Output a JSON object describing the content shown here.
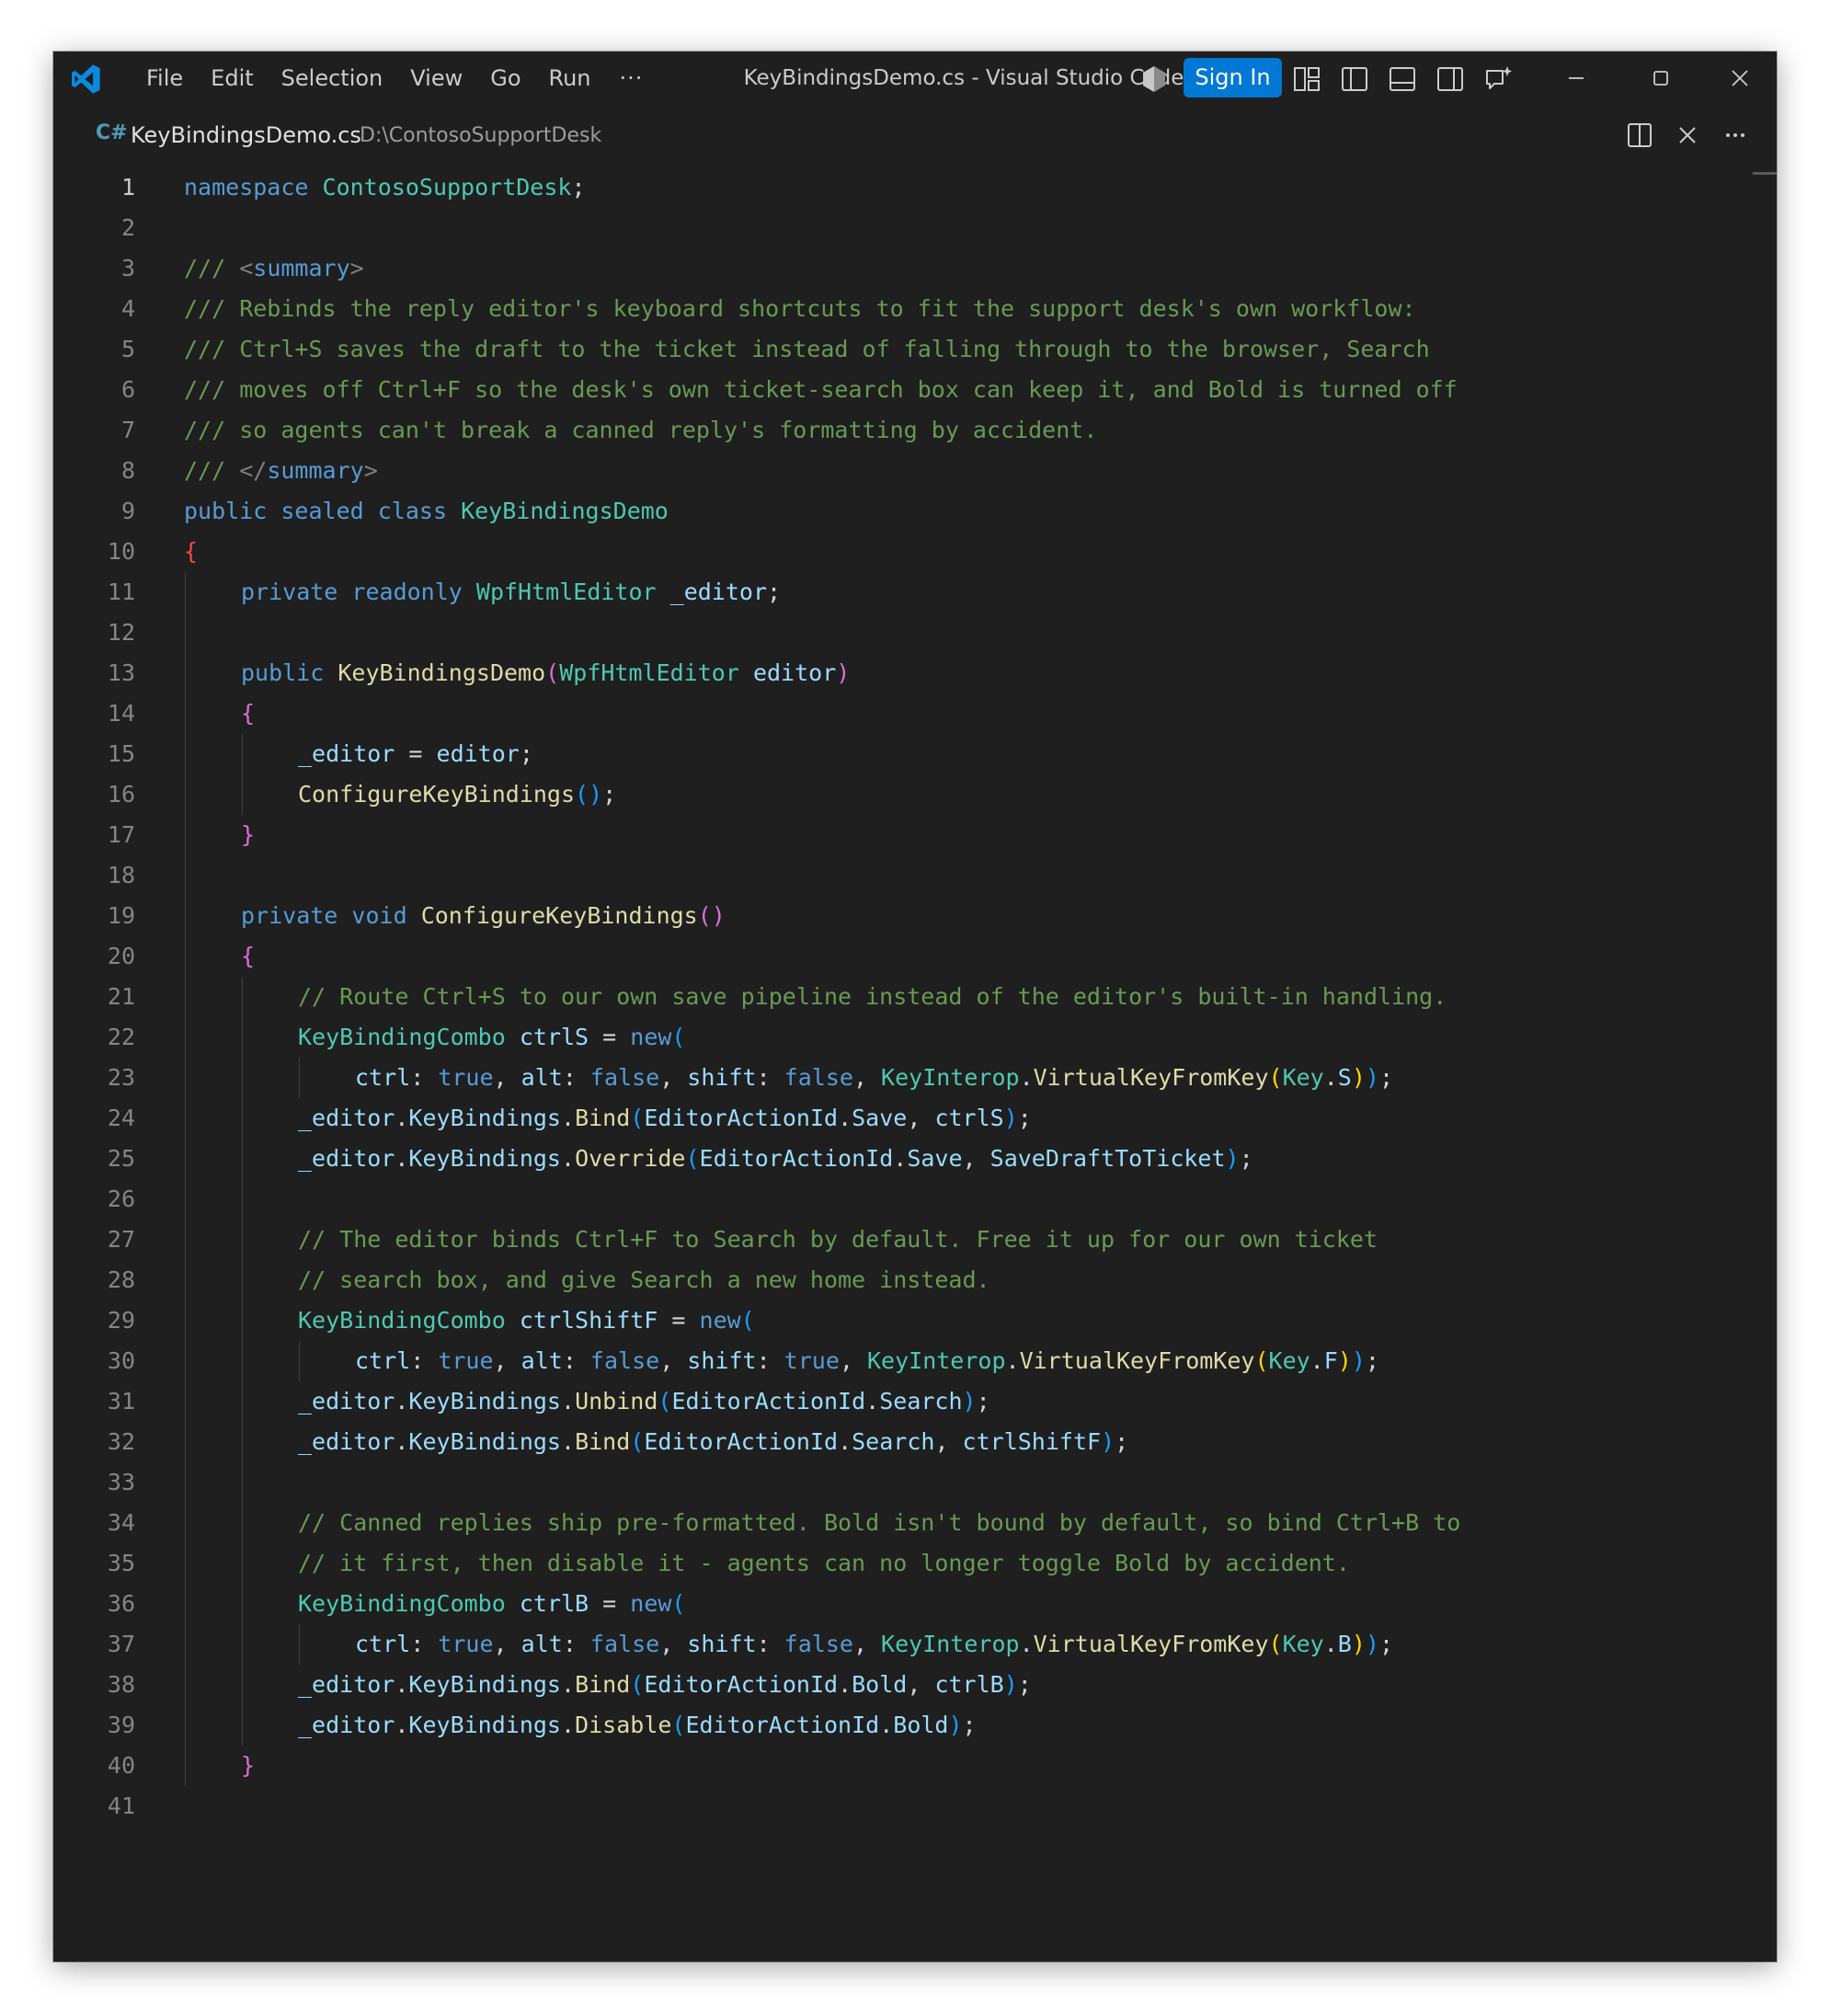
{
  "titlebar": {
    "menu": [
      "File",
      "Edit",
      "Selection",
      "View",
      "Go",
      "Run"
    ],
    "more": "···",
    "title": "KeyBindingsDemo.cs - Visual Studio Code",
    "signin": "Sign In"
  },
  "editor": {
    "file_icon": "C#",
    "file_name": "KeyBindingsDemo.cs",
    "file_path": "D:\\ContosoSupportDesk",
    "active_line": 1
  },
  "code_lines": [
    {
      "n": "1",
      "indent": 0,
      "t": [
        [
          "namespace",
          "kw"
        ],
        [
          " ",
          "pl"
        ],
        [
          "ContosoSupportDesk",
          "ty"
        ],
        [
          ";",
          "pl"
        ]
      ]
    },
    {
      "n": "2",
      "indent": 0,
      "t": []
    },
    {
      "n": "3",
      "indent": 0,
      "t": [
        [
          "/// ",
          "cm"
        ],
        [
          "<",
          "xc"
        ],
        [
          "summary",
          "xd"
        ],
        [
          ">",
          "xc"
        ]
      ]
    },
    {
      "n": "4",
      "indent": 0,
      "t": [
        [
          "/// Rebinds the reply editor's keyboard shortcuts to fit the support desk's own workflow:",
          "cm"
        ]
      ]
    },
    {
      "n": "5",
      "indent": 0,
      "t": [
        [
          "/// Ctrl+S saves the draft to the ticket instead of falling through to the browser, Search",
          "cm"
        ]
      ]
    },
    {
      "n": "6",
      "indent": 0,
      "t": [
        [
          "/// moves off Ctrl+F so the desk's own ticket-search box can keep it, and Bold is turned off",
          "cm"
        ]
      ]
    },
    {
      "n": "7",
      "indent": 0,
      "t": [
        [
          "/// so agents can't break a canned reply's formatting by accident.",
          "cm"
        ]
      ]
    },
    {
      "n": "8",
      "indent": 0,
      "t": [
        [
          "/// ",
          "cm"
        ],
        [
          "</",
          "xc"
        ],
        [
          "summary",
          "xd"
        ],
        [
          ">",
          "xc"
        ]
      ]
    },
    {
      "n": "9",
      "indent": 0,
      "t": [
        [
          "public",
          "kw"
        ],
        [
          " ",
          "pl"
        ],
        [
          "sealed",
          "kw"
        ],
        [
          " ",
          "pl"
        ],
        [
          "class",
          "kw"
        ],
        [
          " ",
          "pl"
        ],
        [
          "KeyBindingsDemo",
          "ty"
        ]
      ]
    },
    {
      "n": "10",
      "indent": 0,
      "t": [
        [
          "{",
          "er"
        ]
      ]
    },
    {
      "n": "11",
      "indent": 1,
      "t": [
        [
          "private",
          "kw"
        ],
        [
          " ",
          "pl"
        ],
        [
          "readonly",
          "kw"
        ],
        [
          " ",
          "pl"
        ],
        [
          "WpfHtmlEditor",
          "ty"
        ],
        [
          " ",
          "pl"
        ],
        [
          "_editor",
          "va"
        ],
        [
          ";",
          "pl"
        ]
      ]
    },
    {
      "n": "12",
      "indent": 0,
      "t": []
    },
    {
      "n": "13",
      "indent": 1,
      "t": [
        [
          "public",
          "kw"
        ],
        [
          " ",
          "pl"
        ],
        [
          "KeyBindingsDemo",
          "fn"
        ],
        [
          "(",
          "b2"
        ],
        [
          "WpfHtmlEditor",
          "ty"
        ],
        [
          " ",
          "pl"
        ],
        [
          "editor",
          "va"
        ],
        [
          ")",
          "b2"
        ]
      ]
    },
    {
      "n": "14",
      "indent": 1,
      "t": [
        [
          "{",
          "b2"
        ]
      ]
    },
    {
      "n": "15",
      "indent": 2,
      "t": [
        [
          "_editor",
          "va"
        ],
        [
          " = ",
          "pl"
        ],
        [
          "editor",
          "va"
        ],
        [
          ";",
          "pl"
        ]
      ]
    },
    {
      "n": "16",
      "indent": 2,
      "t": [
        [
          "ConfigureKeyBindings",
          "fn"
        ],
        [
          "()",
          "b3"
        ],
        [
          ";",
          "pl"
        ]
      ]
    },
    {
      "n": "17",
      "indent": 1,
      "t": [
        [
          "}",
          "b2"
        ]
      ]
    },
    {
      "n": "18",
      "indent": 0,
      "t": []
    },
    {
      "n": "19",
      "indent": 1,
      "t": [
        [
          "private",
          "kw"
        ],
        [
          " ",
          "pl"
        ],
        [
          "void",
          "kw"
        ],
        [
          " ",
          "pl"
        ],
        [
          "ConfigureKeyBindings",
          "fn"
        ],
        [
          "()",
          "b2"
        ]
      ]
    },
    {
      "n": "20",
      "indent": 1,
      "t": [
        [
          "{",
          "b2"
        ]
      ]
    },
    {
      "n": "21",
      "indent": 2,
      "t": [
        [
          "// Route Ctrl+S to our own save pipeline instead of the editor's built-in handling.",
          "cm"
        ]
      ]
    },
    {
      "n": "22",
      "indent": 2,
      "t": [
        [
          "KeyBindingCombo",
          "ty"
        ],
        [
          " ",
          "pl"
        ],
        [
          "ctrlS",
          "va"
        ],
        [
          " = ",
          "pl"
        ],
        [
          "new",
          "kw"
        ],
        [
          "(",
          "b3"
        ]
      ]
    },
    {
      "n": "23",
      "indent": 3,
      "t": [
        [
          "ctrl",
          "va"
        ],
        [
          ": ",
          "pl"
        ],
        [
          "true",
          "kw"
        ],
        [
          ", ",
          "pl"
        ],
        [
          "alt",
          "va"
        ],
        [
          ": ",
          "pl"
        ],
        [
          "false",
          "kw"
        ],
        [
          ", ",
          "pl"
        ],
        [
          "shift",
          "va"
        ],
        [
          ": ",
          "pl"
        ],
        [
          "false",
          "kw"
        ],
        [
          ", ",
          "pl"
        ],
        [
          "KeyInterop",
          "ty"
        ],
        [
          ".",
          "pl"
        ],
        [
          "VirtualKeyFromKey",
          "fn"
        ],
        [
          "(",
          "b1"
        ],
        [
          "Key",
          "ty"
        ],
        [
          ".",
          "pl"
        ],
        [
          "S",
          "va"
        ],
        [
          ")",
          "b1"
        ],
        [
          ")",
          "b3"
        ],
        [
          ";",
          "pl"
        ]
      ]
    },
    {
      "n": "24",
      "indent": 2,
      "t": [
        [
          "_editor",
          "va"
        ],
        [
          ".",
          "pl"
        ],
        [
          "KeyBindings",
          "va"
        ],
        [
          ".",
          "pl"
        ],
        [
          "Bind",
          "fn"
        ],
        [
          "(",
          "b3"
        ],
        [
          "EditorActionId",
          "va"
        ],
        [
          ".",
          "pl"
        ],
        [
          "Save",
          "va"
        ],
        [
          ", ",
          "pl"
        ],
        [
          "ctrlS",
          "va"
        ],
        [
          ")",
          "b3"
        ],
        [
          ";",
          "pl"
        ]
      ]
    },
    {
      "n": "25",
      "indent": 2,
      "t": [
        [
          "_editor",
          "va"
        ],
        [
          ".",
          "pl"
        ],
        [
          "KeyBindings",
          "va"
        ],
        [
          ".",
          "pl"
        ],
        [
          "Override",
          "fn"
        ],
        [
          "(",
          "b3"
        ],
        [
          "EditorActionId",
          "va"
        ],
        [
          ".",
          "pl"
        ],
        [
          "Save",
          "va"
        ],
        [
          ", ",
          "pl"
        ],
        [
          "SaveDraftToTicket",
          "va"
        ],
        [
          ")",
          "b3"
        ],
        [
          ";",
          "pl"
        ]
      ]
    },
    {
      "n": "26",
      "indent": 0,
      "t": []
    },
    {
      "n": "27",
      "indent": 2,
      "t": [
        [
          "// The editor binds Ctrl+F to Search by default. Free it up for our own ticket",
          "cm"
        ]
      ]
    },
    {
      "n": "28",
      "indent": 2,
      "t": [
        [
          "// search box, and give Search a new home instead.",
          "cm"
        ]
      ]
    },
    {
      "n": "29",
      "indent": 2,
      "t": [
        [
          "KeyBindingCombo",
          "ty"
        ],
        [
          " ",
          "pl"
        ],
        [
          "ctrlShiftF",
          "va"
        ],
        [
          " = ",
          "pl"
        ],
        [
          "new",
          "kw"
        ],
        [
          "(",
          "b3"
        ]
      ]
    },
    {
      "n": "30",
      "indent": 3,
      "t": [
        [
          "ctrl",
          "va"
        ],
        [
          ": ",
          "pl"
        ],
        [
          "true",
          "kw"
        ],
        [
          ", ",
          "pl"
        ],
        [
          "alt",
          "va"
        ],
        [
          ": ",
          "pl"
        ],
        [
          "false",
          "kw"
        ],
        [
          ", ",
          "pl"
        ],
        [
          "shift",
          "va"
        ],
        [
          ": ",
          "pl"
        ],
        [
          "true",
          "kw"
        ],
        [
          ", ",
          "pl"
        ],
        [
          "KeyInterop",
          "ty"
        ],
        [
          ".",
          "pl"
        ],
        [
          "VirtualKeyFromKey",
          "fn"
        ],
        [
          "(",
          "b1"
        ],
        [
          "Key",
          "ty"
        ],
        [
          ".",
          "pl"
        ],
        [
          "F",
          "va"
        ],
        [
          ")",
          "b1"
        ],
        [
          ")",
          "b3"
        ],
        [
          ";",
          "pl"
        ]
      ]
    },
    {
      "n": "31",
      "indent": 2,
      "t": [
        [
          "_editor",
          "va"
        ],
        [
          ".",
          "pl"
        ],
        [
          "KeyBindings",
          "va"
        ],
        [
          ".",
          "pl"
        ],
        [
          "Unbind",
          "fn"
        ],
        [
          "(",
          "b3"
        ],
        [
          "EditorActionId",
          "va"
        ],
        [
          ".",
          "pl"
        ],
        [
          "Search",
          "va"
        ],
        [
          ")",
          "b3"
        ],
        [
          ";",
          "pl"
        ]
      ]
    },
    {
      "n": "32",
      "indent": 2,
      "t": [
        [
          "_editor",
          "va"
        ],
        [
          ".",
          "pl"
        ],
        [
          "KeyBindings",
          "va"
        ],
        [
          ".",
          "pl"
        ],
        [
          "Bind",
          "fn"
        ],
        [
          "(",
          "b3"
        ],
        [
          "EditorActionId",
          "va"
        ],
        [
          ".",
          "pl"
        ],
        [
          "Search",
          "va"
        ],
        [
          ", ",
          "pl"
        ],
        [
          "ctrlShiftF",
          "va"
        ],
        [
          ")",
          "b3"
        ],
        [
          ";",
          "pl"
        ]
      ]
    },
    {
      "n": "33",
      "indent": 0,
      "t": []
    },
    {
      "n": "34",
      "indent": 2,
      "t": [
        [
          "// Canned replies ship pre-formatted. Bold isn't bound by default, so bind Ctrl+B to",
          "cm"
        ]
      ]
    },
    {
      "n": "35",
      "indent": 2,
      "t": [
        [
          "// it first, then disable it - agents can no longer toggle Bold by accident.",
          "cm"
        ]
      ]
    },
    {
      "n": "36",
      "indent": 2,
      "t": [
        [
          "KeyBindingCombo",
          "ty"
        ],
        [
          " ",
          "pl"
        ],
        [
          "ctrlB",
          "va"
        ],
        [
          " = ",
          "pl"
        ],
        [
          "new",
          "kw"
        ],
        [
          "(",
          "b3"
        ]
      ]
    },
    {
      "n": "37",
      "indent": 3,
      "t": [
        [
          "ctrl",
          "va"
        ],
        [
          ": ",
          "pl"
        ],
        [
          "true",
          "kw"
        ],
        [
          ", ",
          "pl"
        ],
        [
          "alt",
          "va"
        ],
        [
          ": ",
          "pl"
        ],
        [
          "false",
          "kw"
        ],
        [
          ", ",
          "pl"
        ],
        [
          "shift",
          "va"
        ],
        [
          ": ",
          "pl"
        ],
        [
          "false",
          "kw"
        ],
        [
          ", ",
          "pl"
        ],
        [
          "KeyInterop",
          "ty"
        ],
        [
          ".",
          "pl"
        ],
        [
          "VirtualKeyFromKey",
          "fn"
        ],
        [
          "(",
          "b1"
        ],
        [
          "Key",
          "ty"
        ],
        [
          ".",
          "pl"
        ],
        [
          "B",
          "va"
        ],
        [
          ")",
          "b1"
        ],
        [
          ")",
          "b3"
        ],
        [
          ";",
          "pl"
        ]
      ]
    },
    {
      "n": "38",
      "indent": 2,
      "t": [
        [
          "_editor",
          "va"
        ],
        [
          ".",
          "pl"
        ],
        [
          "KeyBindings",
          "va"
        ],
        [
          ".",
          "pl"
        ],
        [
          "Bind",
          "fn"
        ],
        [
          "(",
          "b3"
        ],
        [
          "EditorActionId",
          "va"
        ],
        [
          ".",
          "pl"
        ],
        [
          "Bold",
          "va"
        ],
        [
          ", ",
          "pl"
        ],
        [
          "ctrlB",
          "va"
        ],
        [
          ")",
          "b3"
        ],
        [
          ";",
          "pl"
        ]
      ]
    },
    {
      "n": "39",
      "indent": 2,
      "t": [
        [
          "_editor",
          "va"
        ],
        [
          ".",
          "pl"
        ],
        [
          "KeyBindings",
          "va"
        ],
        [
          ".",
          "pl"
        ],
        [
          "Disable",
          "fn"
        ],
        [
          "(",
          "b3"
        ],
        [
          "EditorActionId",
          "va"
        ],
        [
          ".",
          "pl"
        ],
        [
          "Bold",
          "va"
        ],
        [
          ")",
          "b3"
        ],
        [
          ";",
          "pl"
        ]
      ]
    },
    {
      "n": "40",
      "indent": 1,
      "t": [
        [
          "}",
          "b2"
        ]
      ]
    },
    {
      "n": "41",
      "indent": 0,
      "t": []
    }
  ]
}
